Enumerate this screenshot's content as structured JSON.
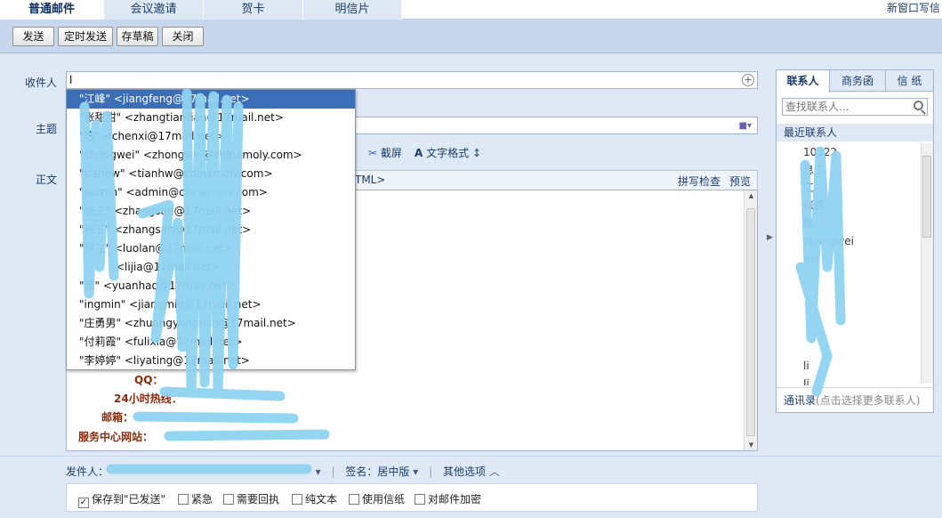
{
  "tabs": [
    {
      "label": "普通邮件",
      "active": true
    },
    {
      "label": "会议邀请",
      "active": false
    },
    {
      "label": "贺卡",
      "active": false
    },
    {
      "label": "明信片",
      "active": false
    }
  ],
  "new_window_label": "新窗口写信",
  "toolbar": {
    "send": "发送",
    "scheduled_send": "定时发送",
    "save_draft": "存草稿",
    "close": "关闭"
  },
  "compose": {
    "recipient_label": "收件人",
    "recipient_value": "l",
    "subject_label": "主题",
    "body_label": "正文",
    "tools": {
      "screenshot": "截屏",
      "text_format": "文字格式"
    },
    "html_tag": "TML>",
    "spell_check": "拼写检查",
    "preview": "预览"
  },
  "autocomplete": [
    "\"江峰\" <jiangfeng@17mail.net>",
    "\"张甜甜\" <zhangtiantian@17mail.net>",
    "\"陈\" <chenxi@17mail.net>",
    "\"zhongwei\" <zhongwei@chinamoly.com>",
    "\"tianhw\" <tianhw@chinamoly.com>",
    "\"admin\" <admin@chinamoly.com>",
    "\"张三\" <zhangsan@17mail.net>",
    "\"张三\" <zhangsan@17mail.net>",
    "\"罗兰\" <luolan@17mail.net>",
    "<lijia@17mail.net>",
    "\"源\" <yuanhao@17mail.net>",
    "\"ingmin\" <jiangmin@17mail.net>",
    "\"庄勇男\" <zhuangyongnan@17mail.net>",
    "\"付莉霞\" <fulixia@17mail.net>",
    "\"李婷婷\" <liyating@17mail.net>"
  ],
  "signature": {
    "qq": "QQ：",
    "hotline": "24小时热线：",
    "email": "邮箱：",
    "website": "服务中心网站："
  },
  "side_panel": {
    "tabs": [
      "联系人",
      "商务函",
      "信 纸"
    ],
    "search_placeholder": "查找联系人...",
    "recent_header": "最近联系人",
    "contacts": [
      "10322",
      "息工",
      "江",
      "张甜",
      "陈",
      "zhongwei",
      "nh",
      "",
      "",
      "",
      "",
      "",
      "li",
      "Ii"
    ],
    "footer_link": "通讯录",
    "footer_hint": "(点击选择更多联系人)"
  },
  "bottom": {
    "sender_label": "发件人：",
    "signature_label": "签名：居中版",
    "other_options": "其他选项",
    "options": [
      {
        "label": "保存到\"已发送\"",
        "checked": true
      },
      {
        "label": "紧急",
        "checked": false
      },
      {
        "label": "需要回执",
        "checked": false
      },
      {
        "label": "纯文本",
        "checked": false
      },
      {
        "label": "使用信纸",
        "checked": false
      },
      {
        "label": "对邮件加密",
        "checked": false
      }
    ]
  },
  "colors": {
    "accent": "#3a6fb8",
    "background": "#dfe9f6",
    "signature_text": "#8b2a0a",
    "redaction": "#8fd3f2"
  }
}
